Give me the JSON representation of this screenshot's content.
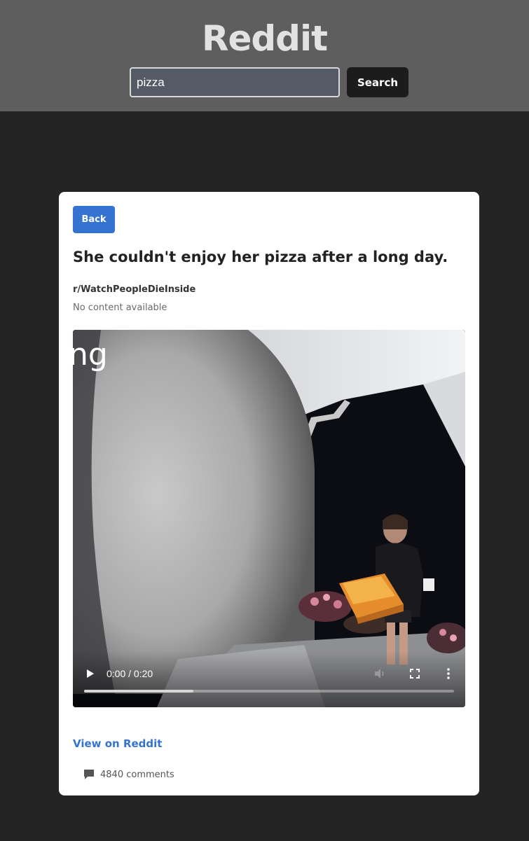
{
  "header": {
    "site_title": "Reddit",
    "search_value": "pizza",
    "search_button": "Search"
  },
  "post": {
    "back_label": "Back",
    "title": "She couldn't enjoy her pizza after a long day.",
    "subreddit": "r/WatchPeopleDieInside",
    "content_text": "No content available",
    "video": {
      "time": "0:00 / 0:20",
      "progress_fraction": 0.295,
      "overlay_text": "ng"
    },
    "view_link": "View on Reddit",
    "comments": "4840 comments"
  },
  "colors": {
    "header_bg": "#5e5e5e",
    "page_bg": "#242424",
    "accent": "#3474d0"
  }
}
